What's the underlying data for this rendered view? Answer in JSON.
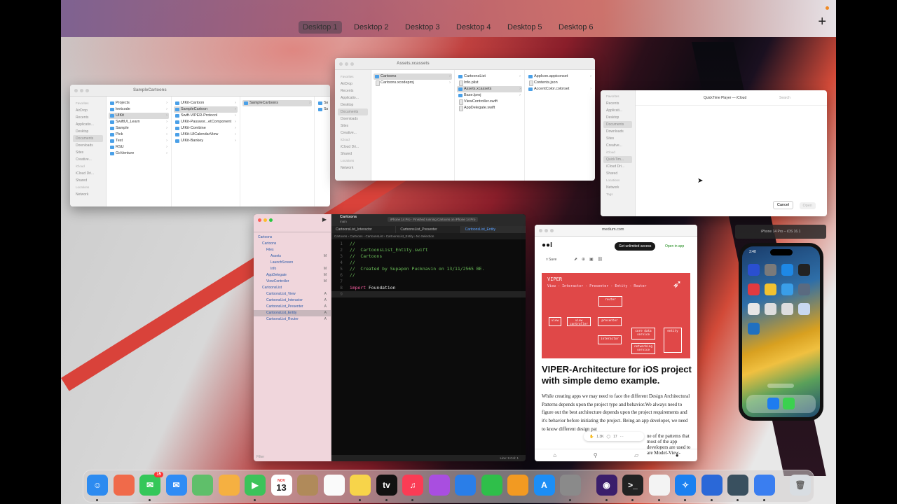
{
  "spaces": [
    "Desktop 1",
    "Desktop 2",
    "Desktop 3",
    "Desktop 4",
    "Desktop 5",
    "Desktop 6"
  ],
  "active_space": "Desktop 1",
  "add_space_symbol": "+",
  "finder1": {
    "title": "SampleCartoons",
    "sidebar": [
      "Favorites",
      "AirDrop",
      "Recents",
      "Applicatio...",
      "Desktop",
      "Documents",
      "Downloads",
      "Sites",
      "Creative...",
      "iCloud",
      "iCloud Dri...",
      "Shared",
      "Locations",
      "Network"
    ],
    "col1": [
      "Projects",
      "leetcode",
      "UIKit",
      "SwiftUI_Learn",
      "Sample",
      "Pick",
      "Test",
      "RSU",
      "GoVenture"
    ],
    "col2": [
      "UIKit-Cartoon",
      "SampleCartoon",
      "Swift-VIPER-Protocol",
      "UIKit-Passwor...etComponent",
      "UIKit-Combine",
      "UIKit-UICalendarView",
      "UIKit-Bankey"
    ],
    "col3": [
      "SampleCartoons"
    ],
    "col4": [
      "Sa",
      "Sa"
    ]
  },
  "finder2": {
    "title": "Assets.xcassets",
    "sidebar": [
      "Favorites",
      "AirDrop",
      "Recents",
      "Applicatio...",
      "Desktop",
      "Documents",
      "Downloads",
      "Sites",
      "Creative...",
      "iCloud",
      "iCloud Dri...",
      "Shared",
      "Locations",
      "Network"
    ],
    "col1": [
      "Cartoons",
      "Cartoons.xcodeproj"
    ],
    "col2": [
      "CartoonsList",
      "Info.plist",
      "Assets.xcassets",
      "Base.lproj",
      "ViewController.swift",
      "AppDelegate.swift"
    ],
    "col3": [
      "AppIcon.appiconset",
      "Contents.json",
      "AccentColor.colorset"
    ]
  },
  "quicktime": {
    "location": "QuickTime Player — iCloud",
    "search_placeholder": "Search",
    "sidebar": [
      "Favorites",
      "Recents",
      "Applicati...",
      "Desktop",
      "Documents",
      "Downloads",
      "Sites",
      "Creative...",
      "iCloud",
      "QuickTim...",
      "iCloud Dri...",
      "Shared",
      "Locations",
      "Network",
      "Tags"
    ],
    "cancel": "Cancel",
    "open": "Open"
  },
  "xcode": {
    "project": "Cartoons",
    "branch": "main",
    "status": "iPhone 14 Pro · Finished running Cartoons on iPhone 14 Pro",
    "tabs": [
      "CartoonsList_Interactor",
      "CartoonsList_Presenter",
      "CartoonsList_Entity"
    ],
    "breadcrumb": [
      "Cartoons",
      "Cartoons",
      "CartoonsList",
      "CartoonsList_Entity",
      "No Selection"
    ],
    "navigator": [
      {
        "name": "Cartoons",
        "level": 0
      },
      {
        "name": "Cartoons",
        "level": 1
      },
      {
        "name": "Files",
        "level": 2
      },
      {
        "name": "Assets",
        "level": 3,
        "badge": "M"
      },
      {
        "name": "LaunchScreen",
        "level": 3
      },
      {
        "name": "Info",
        "level": 3,
        "badge": "M"
      },
      {
        "name": "AppDelegate",
        "level": 2,
        "badge": "M"
      },
      {
        "name": "ViewController",
        "level": 2,
        "badge": "M"
      },
      {
        "name": "CartoonsList",
        "level": 1
      },
      {
        "name": "CartoonsList_View",
        "level": 2,
        "badge": "A"
      },
      {
        "name": "CartoonsList_Interactor",
        "level": 2,
        "badge": "A"
      },
      {
        "name": "CartoonsList_Presenter",
        "level": 2,
        "badge": "A"
      },
      {
        "name": "CartoonsList_Entity",
        "level": 2,
        "badge": "A"
      },
      {
        "name": "CartoonsList_Router",
        "level": 2,
        "badge": "A"
      }
    ],
    "filter_placeholder": "Filter",
    "code": [
      {
        "n": "1",
        "t": "//",
        "c": "cmt"
      },
      {
        "n": "2",
        "t": "//  CartoonsList_Entity.swift",
        "c": "cmt"
      },
      {
        "n": "3",
        "t": "//  Cartoons",
        "c": "cmt"
      },
      {
        "n": "4",
        "t": "//",
        "c": "cmt"
      },
      {
        "n": "5",
        "t": "//  Created by Supapon Pucknavin on 13/11/2565 BE.",
        "c": "cmt"
      },
      {
        "n": "6",
        "t": "//",
        "c": "cmt"
      },
      {
        "n": "7",
        "t": "",
        "c": "plain"
      },
      {
        "n": "8",
        "t": "import Foundation",
        "c": "import"
      },
      {
        "n": "9",
        "t": "",
        "c": "plain"
      }
    ],
    "cursor_status": "Line: 9  Col: 1"
  },
  "safari": {
    "url": "medium.com",
    "get_access": "Get unlimited access",
    "open_in_app": "Open in app",
    "save": "Save",
    "hero_title": "VIPER",
    "hero_subtitle": "View - Interactor - Presenter - Entity - Router",
    "diagram": [
      "router",
      "view",
      "view controller",
      "presenter",
      "interactor",
      "core data service",
      "networking service",
      "entity"
    ],
    "article_title": "VIPER-Architecture for iOS project with simple demo example.",
    "article_body": "While creating apps we may need to face the different Design Architectural Patterns depends upon the project type and behavior.We always need to figure out the best architecture depends upon the project requirements and it's behavior before initiating the project. Being an app developer, we need to know different design pat",
    "article_body2": "ne of the patterns that most of the app developers are used to are Model-View-",
    "claps": "1.3K",
    "comments": "17"
  },
  "simulator": {
    "label": "iPhone 14 Pro – iOS 16.1",
    "time": "3:48"
  },
  "dock": {
    "calendar_month": "NOV",
    "calendar_day": "13",
    "messages_badge": "15",
    "apps": [
      "finder-icon",
      "launchpad-icon",
      "messages-icon",
      "mail-icon",
      "maps-icon",
      "photos-icon",
      "facetime-icon",
      "calendar-icon",
      "contacts-icon",
      "reminders-icon",
      "notes-icon",
      "tv-icon",
      "music-icon",
      "podcasts-icon",
      "keynote-icon",
      "numbers-icon",
      "pages-icon",
      "app-store-icon",
      "system-settings-icon",
      "github-icon",
      "terminal-icon",
      "chrome-icon",
      "safari-icon",
      "xcode-icon",
      "quicktime-icon",
      "simulator-icon",
      "trash-icon"
    ]
  }
}
